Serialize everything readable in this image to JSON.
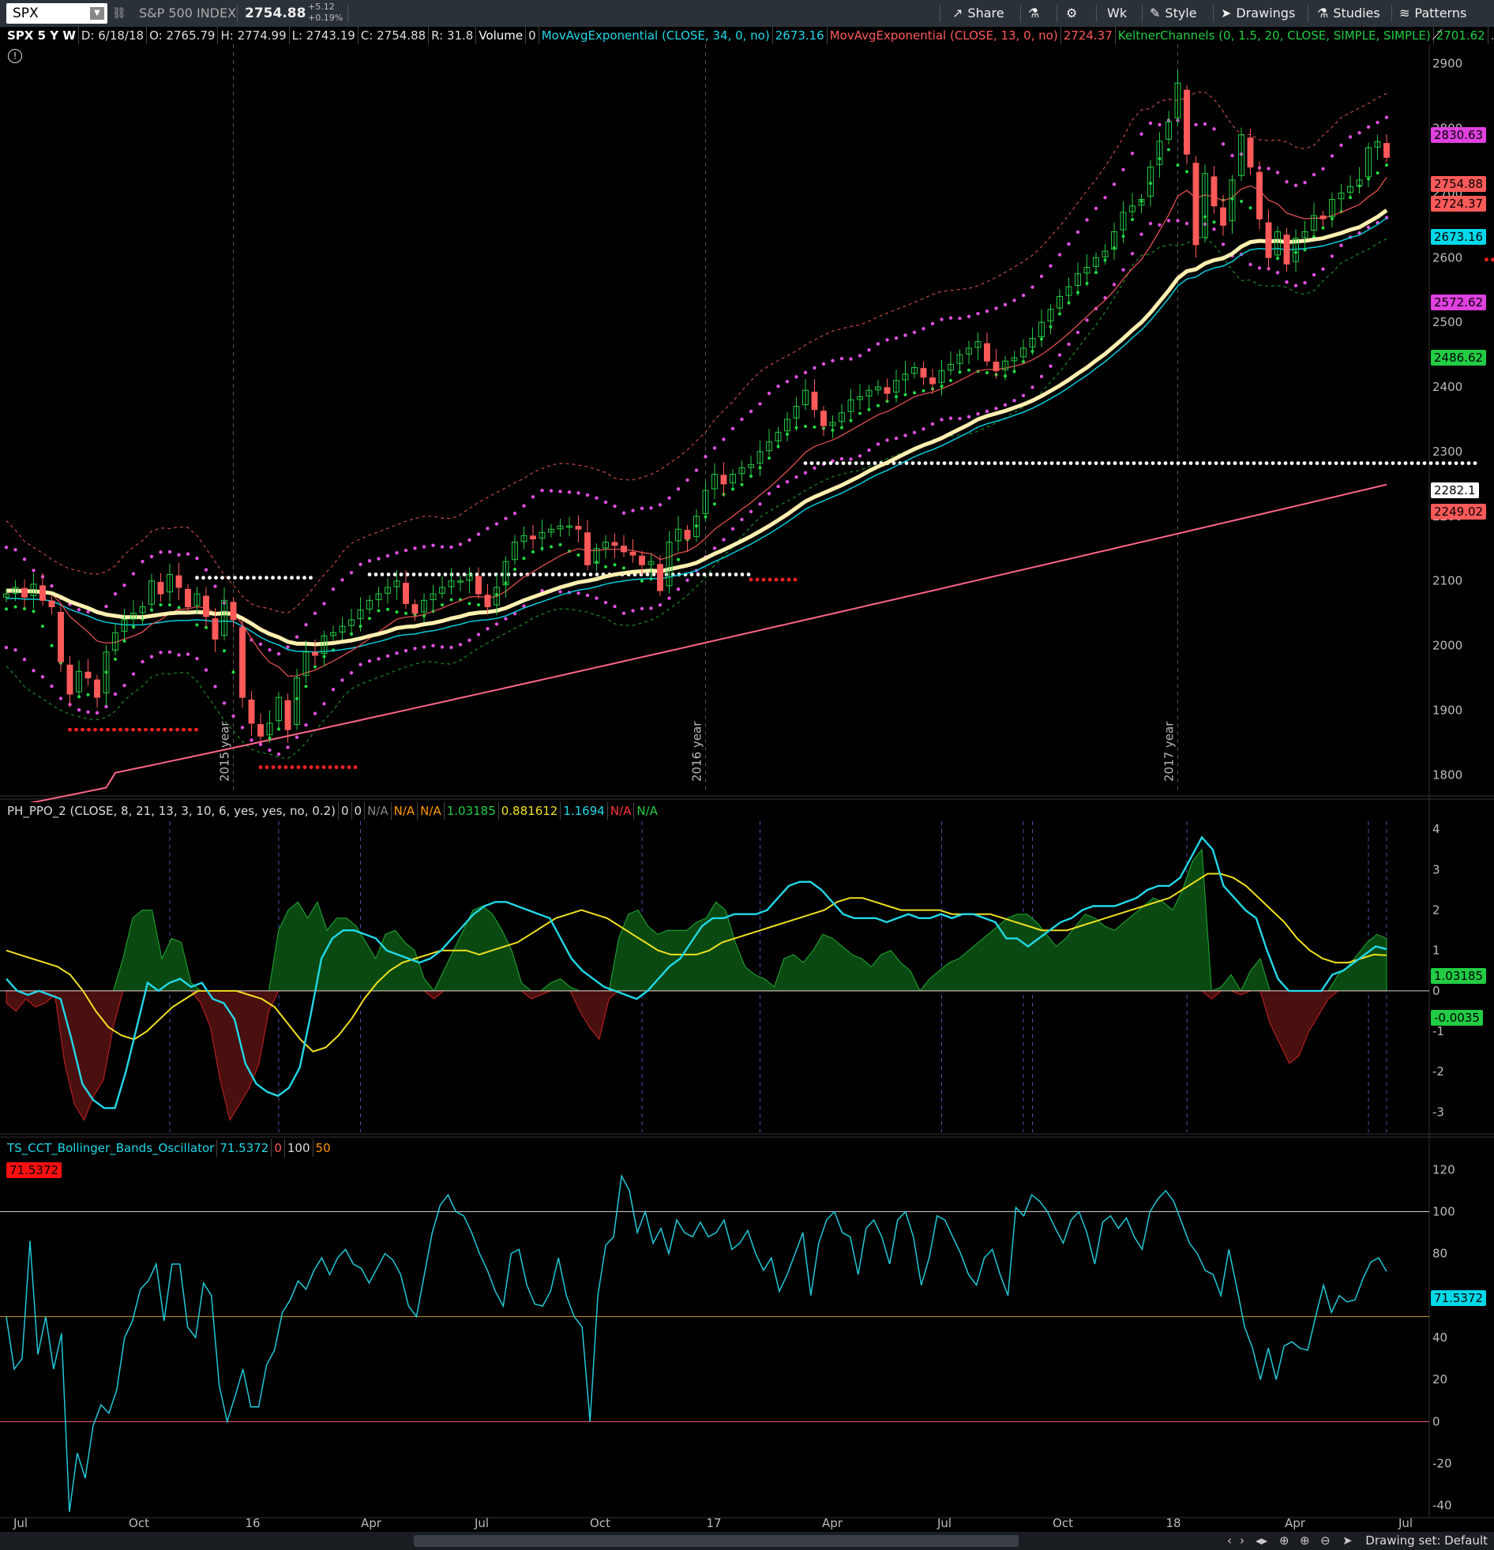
{
  "toolbar": {
    "symbol": "SPX",
    "name": "S&P 500 INDEX",
    "price": "2754.88",
    "change": "+5.12",
    "change_pct": "+0.19%",
    "share": "Share",
    "wk": "Wk",
    "style": "Style",
    "drawings": "Drawings",
    "studies": "Studies",
    "patterns": "Patterns"
  },
  "price_legend": {
    "symbol": "SPX 5 Y W",
    "date": "D: 6/18/18",
    "open": "O: 2765.79",
    "high": "H: 2774.99",
    "low": "L: 2743.19",
    "close": "C: 2754.88",
    "range": "R: 31.8",
    "volume_label": "Volume",
    "volume_value": "0",
    "ema34": "MovAvgExponential (CLOSE, 34, 0, no)",
    "ema34_value": "2673.16",
    "ema13": "MovAvgExponential (CLOSE, 13, 0, no)",
    "ema13_value": "2724.37",
    "keltner": "KeltnerChannels (0, 1.5, 20, CLOSE, SIMPLE, SIMPLE)",
    "keltner_value": "2701.62",
    "more": "..."
  },
  "ppo_legend": {
    "name": "PH_PPO_2 (CLOSE, 8, 21, 13, 3, 10, 6, yes, yes, no, 0.2)",
    "v1": "0",
    "v2": "0",
    "v3": "N/A",
    "v4": "N/A",
    "v5": "N/A",
    "v6": "1.03185",
    "v7": "0.881612",
    "v8": "1.1694",
    "v9": "N/A",
    "v10": "N/A"
  },
  "osc_legend": {
    "name": "TS_CCT_Bollinger_Bands_Oscillator",
    "v1": "71.5372",
    "v2": "0",
    "v3": "100",
    "v4": "50",
    "badge": "71.5372"
  },
  "price_labels": [
    {
      "text": "2830.63",
      "value": 2830.63,
      "bg": "#e040e0"
    },
    {
      "text": "2754.88",
      "value": 2754.88,
      "bg": "#ff5a5a"
    },
    {
      "text": "2724.37",
      "value": 2724.37,
      "bg": "#ff5a5a"
    },
    {
      "text": "2673.16",
      "value": 2673.16,
      "bg": "#00d8e8"
    },
    {
      "text": "2572.62",
      "value": 2572.62,
      "bg": "#e040e0"
    },
    {
      "text": "2486.62",
      "value": 2486.62,
      "bg": "#22cc44"
    },
    {
      "text": "2282.1",
      "value": 2282.1,
      "bg": "#ffffff"
    },
    {
      "text": "2249.02",
      "value": 2249.02,
      "bg": "#ff5a5a"
    }
  ],
  "ppo_labels": [
    {
      "text": "1.03185",
      "value": 1.03185,
      "bg": "#22cc44"
    },
    {
      "text": "-0.0035",
      "value": -0.0035,
      "bg": "#22cc44"
    }
  ],
  "osc_label": {
    "text": "71.5372",
    "value": 71.5372,
    "bg": "#00d8e8"
  },
  "chart_data": [
    {
      "type": "candlestick",
      "title": "SPX 5 Y W",
      "ylim": [
        1770,
        2930
      ],
      "yticks": [
        1800,
        1900,
        2000,
        2100,
        2200,
        2300,
        2400,
        2500,
        2600,
        2700,
        2800,
        2900
      ],
      "year_markers": [
        "2015 year",
        "2016 year",
        "2017 year"
      ],
      "close": [
        2080,
        2090,
        2075,
        2095,
        2070,
        2060,
        1975,
        1925,
        1960,
        1950,
        1920,
        1990,
        2020,
        2040,
        2050,
        2060,
        2100,
        2080,
        2110,
        2090,
        2060,
        2080,
        2045,
        2010,
        2070,
        2040,
        1920,
        1880,
        1860,
        1880,
        1920,
        1870,
        1950,
        1990,
        1985,
        2015,
        2020,
        2030,
        2040,
        2055,
        2070,
        2080,
        2090,
        2100,
        2065,
        2050,
        2070,
        2080,
        2090,
        2100,
        2100,
        2110,
        2080,
        2060,
        2090,
        2130,
        2160,
        2170,
        2165,
        2175,
        2180,
        2185,
        2185,
        2180,
        2125,
        2150,
        2160,
        2155,
        2145,
        2140,
        2125,
        2130,
        2085,
        2160,
        2180,
        2165,
        2200,
        2240,
        2265,
        2250,
        2265,
        2275,
        2280,
        2300,
        2315,
        2330,
        2350,
        2370,
        2395,
        2365,
        2340,
        2345,
        2360,
        2380,
        2385,
        2395,
        2400,
        2390,
        2410,
        2420,
        2430,
        2415,
        2405,
        2425,
        2435,
        2450,
        2460,
        2470,
        2440,
        2425,
        2440,
        2445,
        2460,
        2475,
        2500,
        2520,
        2540,
        2555,
        2575,
        2585,
        2600,
        2610,
        2640,
        2670,
        2680,
        2690,
        2740,
        2780,
        2810,
        2870,
        2760,
        2620,
        2730,
        2680,
        2650,
        2720,
        2790,
        2740,
        2660,
        2600,
        2640,
        2590,
        2630,
        2640,
        2665,
        2660,
        2690,
        2700,
        2710,
        2720,
        2770,
        2779,
        2755
      ],
      "ema34": [
        2085,
        2085,
        2084,
        2084,
        2083,
        2081,
        2075,
        2068,
        2063,
        2058,
        2052,
        2048,
        2046,
        2044,
        2044,
        2044,
        2046,
        2048,
        2050,
        2051,
        2051,
        2052,
        2051,
        2049,
        2050,
        2049,
        2042,
        2034,
        2025,
        2018,
        2013,
        2006,
        2003,
        2003,
        2002,
        2003,
        2004,
        2006,
        2008,
        2011,
        2015,
        2018,
        2022,
        2027,
        2029,
        2030,
        2033,
        2035,
        2038,
        2042,
        2045,
        2049,
        2051,
        2052,
        2054,
        2058,
        2064,
        2070,
        2075,
        2080,
        2085,
        2090,
        2094,
        2098,
        2100,
        2103,
        2107,
        2110,
        2112,
        2114,
        2115,
        2116,
        2115,
        2118,
        2121,
        2124,
        2128,
        2135,
        2142,
        2148,
        2155,
        2162,
        2169,
        2177,
        2185,
        2194,
        2203,
        2213,
        2223,
        2230,
        2236,
        2242,
        2248,
        2255,
        2262,
        2270,
        2277,
        2283,
        2290,
        2297,
        2304,
        2310,
        2315,
        2321,
        2328,
        2335,
        2342,
        2350,
        2355,
        2359,
        2363,
        2368,
        2373,
        2379,
        2386,
        2394,
        2402,
        2411,
        2421,
        2430,
        2441,
        2451,
        2463,
        2475,
        2488,
        2500,
        2515,
        2532,
        2549,
        2568,
        2579,
        2582,
        2591,
        2596,
        2599,
        2606,
        2617,
        2624,
        2626,
        2625,
        2626,
        2624,
        2625,
        2626,
        2628,
        2630,
        2634,
        2638,
        2643,
        2647,
        2655,
        2663,
        2673.16
      ],
      "ema13": [
        2082,
        2083,
        2082,
        2084,
        2083,
        2080,
        2065,
        2045,
        2033,
        2021,
        2007,
        2004,
        2005,
        2010,
        2015,
        2021,
        2033,
        2040,
        2050,
        2056,
        2057,
        2060,
        2058,
        2051,
        2053,
        2051,
        2033,
        2011,
        1990,
        1974,
        1967,
        1953,
        1953,
        1958,
        1962,
        1969,
        1976,
        1984,
        1992,
        2001,
        2011,
        2021,
        2031,
        2041,
        2044,
        2045,
        2048,
        2053,
        2058,
        2064,
        2069,
        2075,
        2076,
        2074,
        2076,
        2084,
        2095,
        2106,
        2114,
        2123,
        2131,
        2139,
        2145,
        2150,
        2147,
        2147,
        2149,
        2149,
        2149,
        2147,
        2144,
        2142,
        2133,
        2137,
        2143,
        2146,
        2154,
        2166,
        2180,
        2190,
        2200,
        2211,
        2221,
        2233,
        2244,
        2257,
        2270,
        2284,
        2299,
        2308,
        2313,
        2318,
        2325,
        2333,
        2341,
        2349,
        2357,
        2362,
        2369,
        2377,
        2385,
        2389,
        2392,
        2397,
        2403,
        2410,
        2417,
        2425,
        2427,
        2427,
        2429,
        2432,
        2436,
        2442,
        2450,
        2460,
        2471,
        2483,
        2496,
        2509,
        2522,
        2534,
        2549,
        2567,
        2583,
        2597,
        2618,
        2642,
        2666,
        2695,
        2704,
        2692,
        2697,
        2694,
        2688,
        2693,
        2706,
        2711,
        2704,
        2689,
        2683,
        2669,
        2664,
        2660,
        2661,
        2661,
        2665,
        2670,
        2676,
        2682,
        2694,
        2704,
        2724.37
      ]
    },
    {
      "type": "line",
      "title": "PH_PPO_2 (CLOSE, 8, 21, 13, 3, 10, 6, yes, yes, no, 0.2)",
      "ylim": [
        -3.5,
        4.2
      ],
      "yticks": [
        -3,
        -2,
        -1,
        0,
        1,
        2,
        3,
        4
      ],
      "histogram": [
        -0.3,
        -0.5,
        -0.2,
        -0.4,
        -0.3,
        -0.1,
        -1.8,
        -2.8,
        -3.2,
        -2.6,
        -2.2,
        -0.9,
        0.8,
        1.8,
        2.0,
        2.0,
        0.8,
        1.3,
        1.2,
        0.2,
        -0.3,
        -0.9,
        -2.2,
        -3.2,
        -2.8,
        -2.4,
        -1.8,
        -0.5,
        1.5,
        2.0,
        2.2,
        1.8,
        2.2,
        1.5,
        1.8,
        1.8,
        1.6,
        1.2,
        0.8,
        1.4,
        1.5,
        1.2,
        1.0,
        0.3,
        -0.2,
        0.5,
        1.0,
        1.5,
        2.0,
        2.1,
        1.9,
        1.5,
        1.0,
        0.2,
        -0.2,
        -0.1,
        0.2,
        0.3,
        0.1,
        -0.5,
        -0.9,
        -1.2,
        -0.2,
        1.3,
        1.9,
        2.0,
        1.6,
        1.4,
        1.5,
        1.5,
        1.5,
        1.7,
        1.8,
        2.2,
        2.0,
        1.2,
        0.6,
        0.4,
        0.3,
        0.1,
        0.8,
        0.9,
        0.7,
        1.0,
        1.4,
        1.3,
        1.1,
        0.9,
        0.8,
        0.6,
        0.9,
        1.0,
        0.7,
        0.5,
        0.0,
        0.3,
        0.5,
        0.7,
        0.8,
        1.0,
        1.2,
        1.4,
        1.6,
        1.8,
        1.9,
        1.9,
        1.7,
        1.4,
        1.1,
        1.3,
        1.6,
        1.9,
        1.8,
        1.6,
        1.5,
        1.7,
        1.9,
        2.1,
        2.3,
        2.2,
        2.0,
        2.5,
        3.2,
        3.5,
        -0.2,
        0.1,
        0.4,
        -0.1,
        0.5,
        0.8,
        -0.8,
        -1.3,
        -1.8,
        -1.6,
        -1.0,
        -0.6,
        -0.2,
        0.4,
        0.6,
        0.9,
        1.2,
        1.4,
        1.3
      ],
      "ppo_line": [
        0.3,
        0.0,
        -0.1,
        0.0,
        -0.1,
        -0.2,
        -1.2,
        -2.3,
        -2.7,
        -2.9,
        -2.9,
        -2.0,
        -0.9,
        0.2,
        0.0,
        0.2,
        0.3,
        0.1,
        0.2,
        -0.2,
        -0.3,
        -0.7,
        -1.8,
        -2.3,
        -2.5,
        -2.6,
        -2.4,
        -1.9,
        -0.6,
        0.8,
        1.3,
        1.5,
        1.5,
        1.4,
        1.3,
        1.0,
        0.9,
        0.8,
        0.7,
        0.8,
        1.0,
        1.3,
        1.6,
        1.9,
        2.1,
        2.2,
        2.2,
        2.1,
        2.0,
        1.9,
        1.8,
        1.3,
        0.8,
        0.5,
        0.3,
        0.1,
        0.0,
        -0.1,
        -0.2,
        0.0,
        0.3,
        0.6,
        0.8,
        1.2,
        1.6,
        1.8,
        1.8,
        1.9,
        1.9,
        1.9,
        2.0,
        2.3,
        2.6,
        2.7,
        2.7,
        2.5,
        2.2,
        1.9,
        1.8,
        1.8,
        1.8,
        1.7,
        1.8,
        1.9,
        1.8,
        1.8,
        1.9,
        1.8,
        1.9,
        1.9,
        1.8,
        1.7,
        1.3,
        1.3,
        1.1,
        1.3,
        1.5,
        1.7,
        1.8,
        2.0,
        2.1,
        2.1,
        2.1,
        2.2,
        2.3,
        2.5,
        2.6,
        2.6,
        2.8,
        3.3,
        3.8,
        3.5,
        2.6,
        2.3,
        2.0,
        1.8,
        1.0,
        0.3,
        0.0,
        0.0,
        0.0,
        0.0,
        0.4,
        0.5,
        0.7,
        0.9,
        1.1,
        1.03185
      ],
      "signal_line": [
        1.0,
        0.9,
        0.8,
        0.7,
        0.6,
        0.4,
        0.0,
        -0.5,
        -0.9,
        -1.1,
        -1.2,
        -1.0,
        -0.7,
        -0.4,
        -0.2,
        0.0,
        0.0,
        0.0,
        0.0,
        -0.1,
        -0.2,
        -0.4,
        -0.8,
        -1.2,
        -1.5,
        -1.4,
        -1.1,
        -0.7,
        -0.2,
        0.2,
        0.5,
        0.7,
        0.8,
        0.9,
        1.0,
        1.0,
        1.0,
        0.9,
        1.0,
        1.1,
        1.2,
        1.4,
        1.6,
        1.8,
        1.9,
        2.0,
        1.9,
        1.8,
        1.6,
        1.4,
        1.2,
        1.0,
        0.9,
        0.9,
        0.9,
        1.0,
        1.2,
        1.3,
        1.4,
        1.5,
        1.6,
        1.7,
        1.8,
        1.9,
        2.0,
        2.2,
        2.3,
        2.3,
        2.2,
        2.1,
        2.0,
        2.0,
        2.0,
        2.0,
        1.9,
        1.9,
        1.9,
        1.9,
        1.8,
        1.7,
        1.6,
        1.5,
        1.5,
        1.5,
        1.6,
        1.7,
        1.8,
        1.9,
        2.0,
        2.1,
        2.2,
        2.3,
        2.5,
        2.7,
        2.9,
        2.9,
        2.8,
        2.6,
        2.3,
        2.0,
        1.7,
        1.3,
        1.0,
        0.8,
        0.7,
        0.7,
        0.8,
        0.9,
        0.88
      ]
    },
    {
      "type": "line",
      "title": "TS_CCT_Bollinger_Bands_Oscillator",
      "ylim": [
        -45,
        125
      ],
      "yticks": [
        -40,
        -20,
        0,
        20,
        40,
        60,
        80,
        100,
        120
      ],
      "levels": [
        0,
        50,
        100
      ],
      "values": [
        50,
        25,
        30,
        86,
        32,
        50,
        25,
        42,
        -43,
        -15,
        -27,
        -2,
        8,
        4,
        15,
        40,
        48,
        63,
        67,
        75,
        48,
        75,
        75,
        45,
        40,
        66,
        60,
        17,
        0,
        12,
        25,
        7,
        7,
        27,
        34,
        52,
        58,
        67,
        63,
        72,
        78,
        70,
        78,
        82,
        75,
        73,
        66,
        73,
        80,
        77,
        70,
        55,
        50,
        70,
        90,
        103,
        108,
        100,
        98,
        90,
        80,
        72,
        62,
        55,
        80,
        82,
        65,
        56,
        55,
        62,
        78,
        60,
        50,
        45,
        0,
        60,
        84,
        88,
        117,
        110,
        90,
        100,
        85,
        92,
        80,
        96,
        90,
        88,
        95,
        88,
        90,
        96,
        82,
        85,
        91,
        80,
        72,
        78,
        62,
        70,
        80,
        90,
        60,
        85,
        96,
        100,
        90,
        88,
        70,
        92,
        96,
        88,
        75,
        96,
        100,
        88,
        65,
        78,
        98,
        96,
        88,
        80,
        70,
        65,
        78,
        82,
        70,
        60,
        102,
        98,
        108,
        105,
        100,
        92,
        85,
        96,
        100,
        90,
        75,
        95,
        98,
        92,
        97,
        88,
        82,
        100,
        106,
        110,
        105,
        95,
        85,
        80,
        72,
        70,
        60,
        82,
        64,
        45,
        35,
        20,
        35,
        20,
        36,
        38,
        35,
        34,
        50,
        65,
        52,
        60,
        57,
        58,
        68,
        76,
        78,
        71.5
      ]
    }
  ],
  "x_axis": [
    "Jul",
    "Oct",
    "16",
    "Apr",
    "Jul",
    "Oct",
    "17",
    "Apr",
    "Jul",
    "Oct",
    "18",
    "Apr",
    "Jul"
  ],
  "bottom": {
    "drawing_set": "Drawing set: Default"
  }
}
